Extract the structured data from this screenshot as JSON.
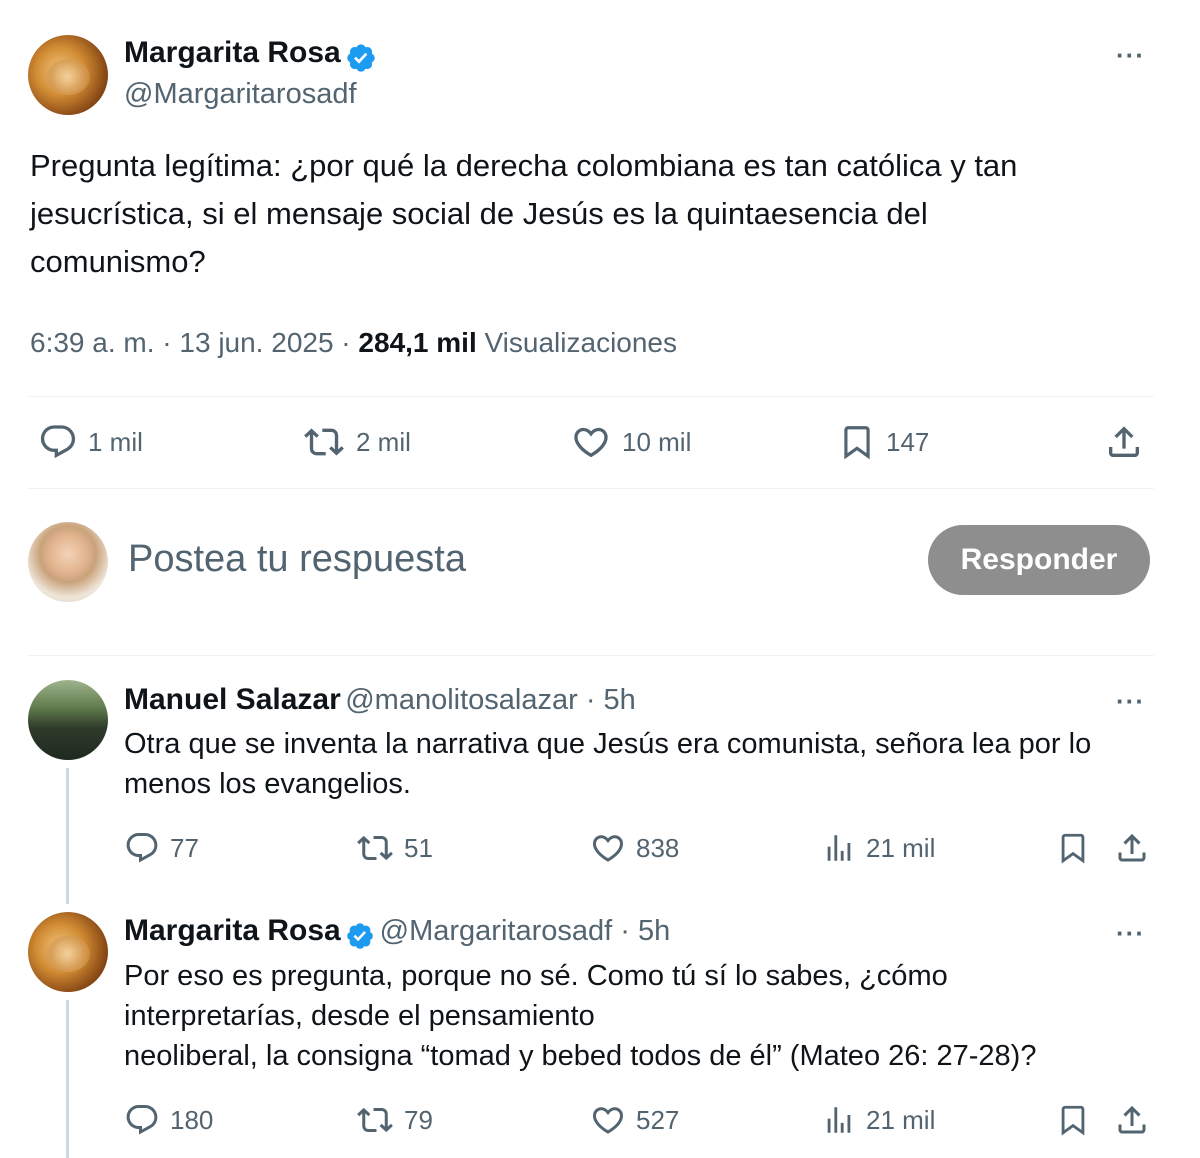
{
  "main_post": {
    "author_name": "Margarita Rosa",
    "author_handle": "@Margaritarosadf",
    "text_lines": [
      "Pregunta legítima: ¿por qué la derecha colombiana es tan católica y tan",
      "jesucrística, si el mensaje social de Jesús es la quintaesencia del",
      "comunismo?"
    ],
    "time": "6:39 a. m. · 13 jun. 2025 · ",
    "views_count": "284,1 mil",
    "views_label": " Visualizaciones",
    "replies": "1 mil",
    "reposts": "2 mil",
    "likes": "10 mil",
    "bookmarks": "147",
    "more": "···"
  },
  "composer": {
    "placeholder": "Postea tu respuesta",
    "button_label": "Responder"
  },
  "replies": [
    {
      "author_name": "Manuel Salazar",
      "author_handle": "@manolitosalazar",
      "time": " · 5h",
      "text_lines": [
        "Otra que se inventa la narrativa que Jesús era comunista, señora lea por lo",
        "menos los evangelios."
      ],
      "replies": "77",
      "reposts": "51",
      "likes": "838",
      "views": "21 mil",
      "more": "···"
    },
    {
      "author_name": "Margarita Rosa",
      "author_handle": "@Margaritarosadf",
      "time": " · 5h",
      "text_lines": [
        "Por eso es pregunta, porque no sé. Como tú sí lo sabes, ¿cómo",
        "interpretarías, desde el pensamiento",
        "neoliberal, la consigna “tomad y bebed todos de él” (Mateo 26: 27-28)?"
      ],
      "replies": "180",
      "reposts": "79",
      "likes": "527",
      "views": "21 mil",
      "more": "···"
    }
  ],
  "colors": {
    "verified": "#1d9bf0",
    "secondary_text": "#536471",
    "button_bg": "#8e8e8e"
  }
}
